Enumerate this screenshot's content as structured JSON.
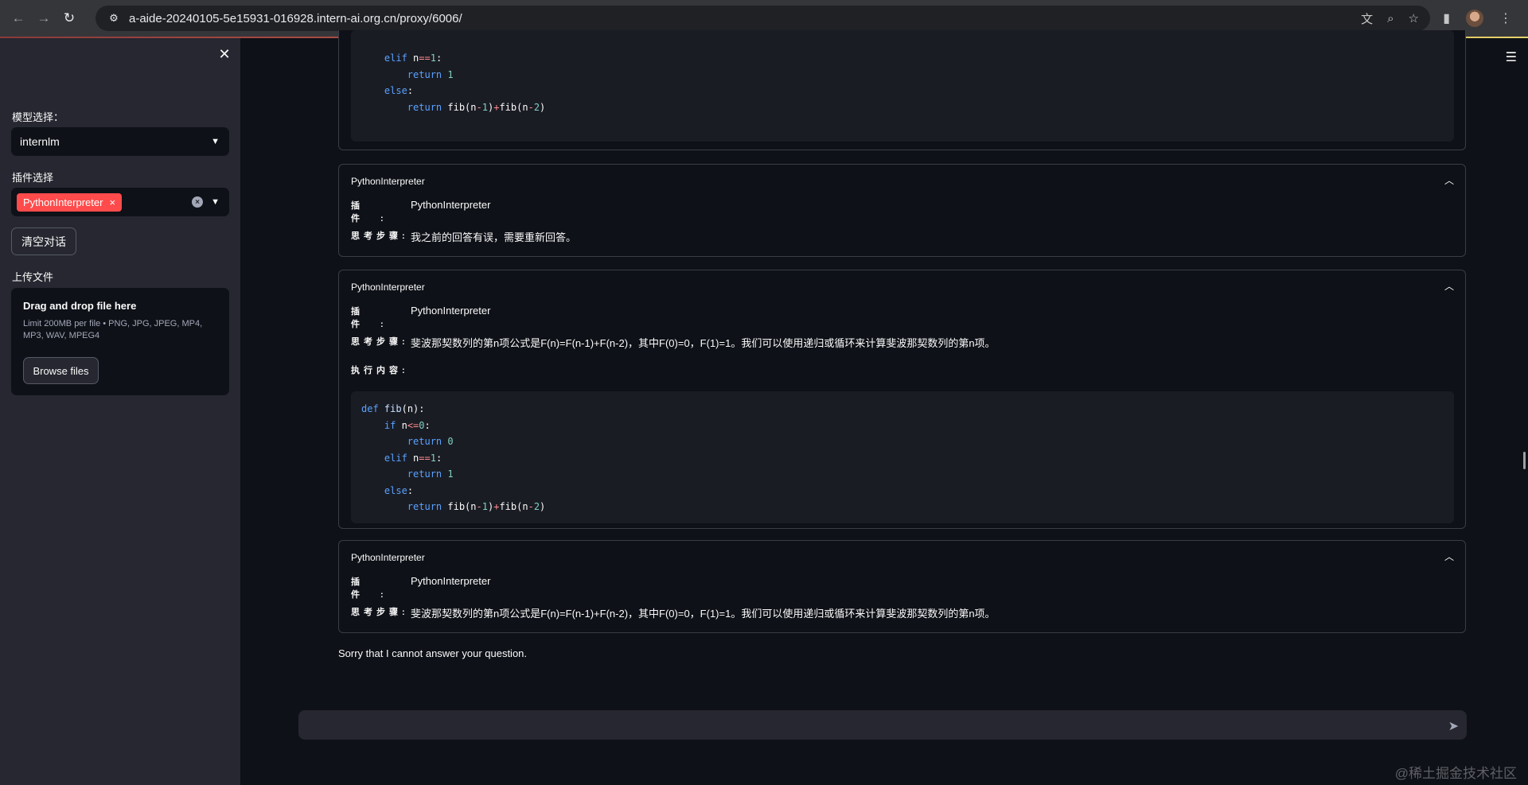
{
  "browser": {
    "url": "a-aide-20240105-5e15931-016928.intern-ai.org.cn/proxy/6006/",
    "back_icon": "←",
    "forward_icon": "→",
    "reload_icon": "↻",
    "site_icon": "⚙",
    "translate_icon": "文",
    "zoom_icon": "⌕",
    "star_icon": "☆",
    "sidepanel_icon": "▮"
  },
  "sidebar": {
    "close_icon": "✕",
    "model_label": "模型选择：",
    "model_value": "internlm",
    "plugin_label": "插件选择",
    "plugin_tag": "PythonInterpreter",
    "plugin_tag_remove": "×",
    "clear_button": "清空对话",
    "upload_label": "上传文件",
    "upload_title": "Drag and drop file here",
    "upload_limits": "Limit 200MB per file • PNG, JPG, JPEG, MP4, MP3, WAV, MPEG4",
    "browse_button": "Browse files"
  },
  "main": {
    "menu_icon": "☰",
    "top_code": {
      "lines": [
        [
          {
            "t": "    "
          },
          {
            "c": "kw",
            "t": "elif"
          },
          {
            "t": " n"
          },
          {
            "c": "op",
            "t": "=="
          },
          {
            "c": "num",
            "t": "1"
          },
          {
            "t": ":"
          }
        ],
        [
          {
            "t": "        "
          },
          {
            "c": "kw",
            "t": "return"
          },
          {
            "t": " "
          },
          {
            "c": "num",
            "t": "1"
          }
        ],
        [
          {
            "t": "    "
          },
          {
            "c": "kw",
            "t": "else"
          },
          {
            "t": ":"
          }
        ],
        [
          {
            "t": "        "
          },
          {
            "c": "kw",
            "t": "return"
          },
          {
            "t": " fib(n"
          },
          {
            "c": "op",
            "t": "-"
          },
          {
            "c": "num",
            "t": "1"
          },
          {
            "t": ")"
          },
          {
            "c": "op",
            "t": "+"
          },
          {
            "t": "fib(n"
          },
          {
            "c": "op",
            "t": "-"
          },
          {
            "c": "num",
            "t": "2"
          },
          {
            "t": ")"
          }
        ]
      ]
    },
    "expanders": [
      {
        "title": "PythonInterpreter",
        "plugin_key": "插 件:",
        "plugin_value": "PythonInterpreter",
        "thought_key": "思考步骤:",
        "thought_value": "我之前的回答有误，需要重新回答。"
      },
      {
        "title": "PythonInterpreter",
        "plugin_key": "插 件:",
        "plugin_value": "PythonInterpreter",
        "thought_key": "思考步骤:",
        "thought_value": "斐波那契数列的第n项公式是F(n)=F(n-1)+F(n-2)，其中F(0)=0，F(1)=1。我们可以使用递归或循环来计算斐波那契数列的第n项。",
        "exec_key": "执行内容:",
        "code": [
          [
            {
              "c": "kw",
              "t": "def"
            },
            {
              "t": " "
            },
            {
              "c": "fn",
              "t": "fib"
            },
            {
              "t": "(n):"
            }
          ],
          [
            {
              "t": "    "
            },
            {
              "c": "kw",
              "t": "if"
            },
            {
              "t": " n"
            },
            {
              "c": "op",
              "t": "<="
            },
            {
              "c": "num",
              "t": "0"
            },
            {
              "t": ":"
            }
          ],
          [
            {
              "t": "        "
            },
            {
              "c": "kw",
              "t": "return"
            },
            {
              "t": " "
            },
            {
              "c": "num",
              "t": "0"
            }
          ],
          [
            {
              "t": "    "
            },
            {
              "c": "kw",
              "t": "elif"
            },
            {
              "t": " n"
            },
            {
              "c": "op",
              "t": "=="
            },
            {
              "c": "num",
              "t": "1"
            },
            {
              "t": ":"
            }
          ],
          [
            {
              "t": "        "
            },
            {
              "c": "kw",
              "t": "return"
            },
            {
              "t": " "
            },
            {
              "c": "num",
              "t": "1"
            }
          ],
          [
            {
              "t": "    "
            },
            {
              "c": "kw",
              "t": "else"
            },
            {
              "t": ":"
            }
          ],
          [
            {
              "t": "        "
            },
            {
              "c": "kw",
              "t": "return"
            },
            {
              "t": " fib(n"
            },
            {
              "c": "op",
              "t": "-"
            },
            {
              "c": "num",
              "t": "1"
            },
            {
              "t": ")"
            },
            {
              "c": "op",
              "t": "+"
            },
            {
              "t": "fib(n"
            },
            {
              "c": "op",
              "t": "-"
            },
            {
              "c": "num",
              "t": "2"
            },
            {
              "t": ")"
            }
          ]
        ]
      },
      {
        "title": "PythonInterpreter",
        "plugin_key": "插 件:",
        "plugin_value": "PythonInterpreter",
        "thought_key": "思考步骤:",
        "thought_value": "斐波那契数列的第n项公式是F(n)=F(n-1)+F(n-2)，其中F(0)=0，F(1)=1。我们可以使用递归或循环来计算斐波那契数列的第n项。"
      }
    ],
    "final_answer": "Sorry that I cannot answer your question.",
    "chat_input_placeholder": "",
    "send_icon": "➤",
    "watermark": "@稀土掘金技术社区",
    "colors": {
      "accent": "#ff4b4b",
      "background": "#0e1117",
      "sidebar": "#262730"
    }
  }
}
